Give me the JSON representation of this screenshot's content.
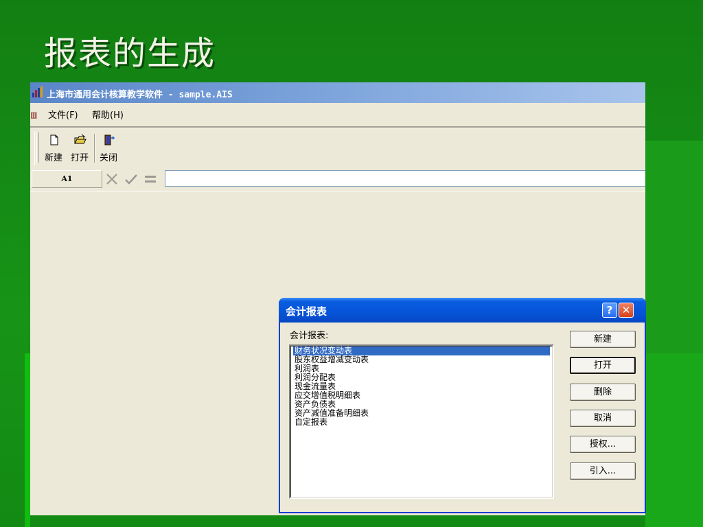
{
  "slide": {
    "title": "报表的生成"
  },
  "app": {
    "title": "上海市通用会计核算教学软件 - sample.AIS",
    "menu": [
      {
        "label": "文件(F)"
      },
      {
        "label": "帮助(H)"
      }
    ],
    "toolbar": [
      {
        "label": "新建",
        "icon": "new-file-icon"
      },
      {
        "label": "打开",
        "icon": "open-folder-icon"
      },
      {
        "label": "关闭",
        "icon": "exit-door-icon"
      }
    ],
    "formula_bar": {
      "cell_ref": "A1",
      "value": ""
    }
  },
  "dialog": {
    "title": "会计报表",
    "list_label": "会计报表:",
    "items": [
      "财务状况变动表",
      "股东权益增减变动表",
      "利润表",
      "利润分配表",
      "现金流量表",
      "应交增值税明细表",
      "资产负债表",
      "资产减值准备明细表",
      "自定报表"
    ],
    "selected_index": 0,
    "buttons": [
      "新建",
      "打开",
      "删除",
      "取消",
      "授权...",
      "引入..."
    ],
    "default_button_index": 1,
    "colors": {
      "title_bar": "#0654d8",
      "selection": "#316ac5",
      "close": "#d8421c"
    }
  }
}
